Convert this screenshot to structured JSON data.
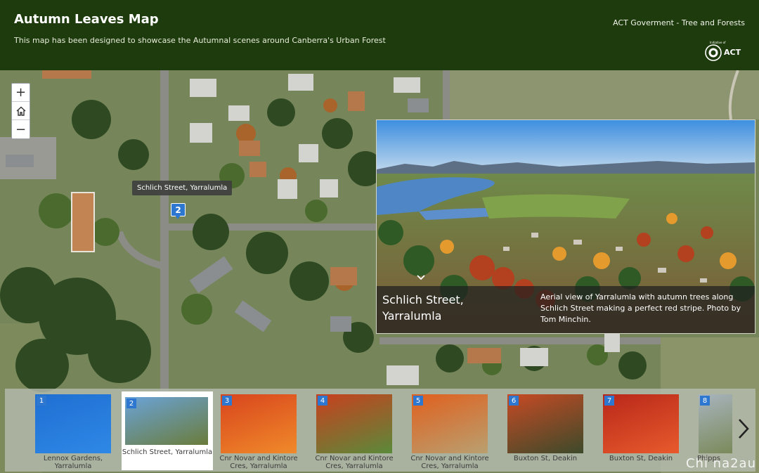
{
  "header": {
    "title": "Autumn Leaves Map",
    "subtitle": "This map has been designed to showcase the Autumnal scenes around Canberra's Urban Forest",
    "org_link": "ACT Goverment - Tree and Forests",
    "logo_text": "ACT",
    "logo_small_text": "Initiative of"
  },
  "map": {
    "zoom_in": "+",
    "home_icon": "home-icon",
    "zoom_out": "−",
    "tooltip": "Schlich Street, Yarralumla",
    "marker_number": "2"
  },
  "popup": {
    "title": "Schlich Street, Yarralumla",
    "description": "Aerial view of Yarralumla with autumn trees along Schlich Street making a perfect red stripe. Photo by Tom Minchin."
  },
  "carousel": {
    "items": [
      {
        "number": "1",
        "label": "Lennox Gardens, Yarralumla",
        "active": false,
        "colors": [
          "#1f6fd1",
          "#2f88e6"
        ]
      },
      {
        "number": "2",
        "label": "Schlich Street, Yarralumla",
        "active": true,
        "colors": [
          "#6aa3d8",
          "#6a7c3a"
        ]
      },
      {
        "number": "3",
        "label": "Cnr Novar and Kintore Cres, Yarralumla",
        "active": false,
        "colors": [
          "#d8451d",
          "#f08a2a"
        ]
      },
      {
        "number": "4",
        "label": "Cnr Novar and Kintore Cres, Yarralumla",
        "active": false,
        "colors": [
          "#c8401e",
          "#5a8a3a"
        ]
      },
      {
        "number": "5",
        "label": "Cnr Novar and Kintore Cres, Yarralumla",
        "active": false,
        "colors": [
          "#e0601e",
          "#b9a070"
        ]
      },
      {
        "number": "6",
        "label": "Buxton St, Deakin",
        "active": false,
        "colors": [
          "#c74a24",
          "#3c4a2a"
        ]
      },
      {
        "number": "7",
        "label": "Buxton St, Deakin",
        "active": false,
        "colors": [
          "#b8281a",
          "#e85a2c"
        ]
      },
      {
        "number": "8",
        "label": "Phipps",
        "active": false,
        "colors": [
          "#a8b4be",
          "#7b8a5a"
        ]
      }
    ]
  },
  "watermark": "Chi na2au"
}
